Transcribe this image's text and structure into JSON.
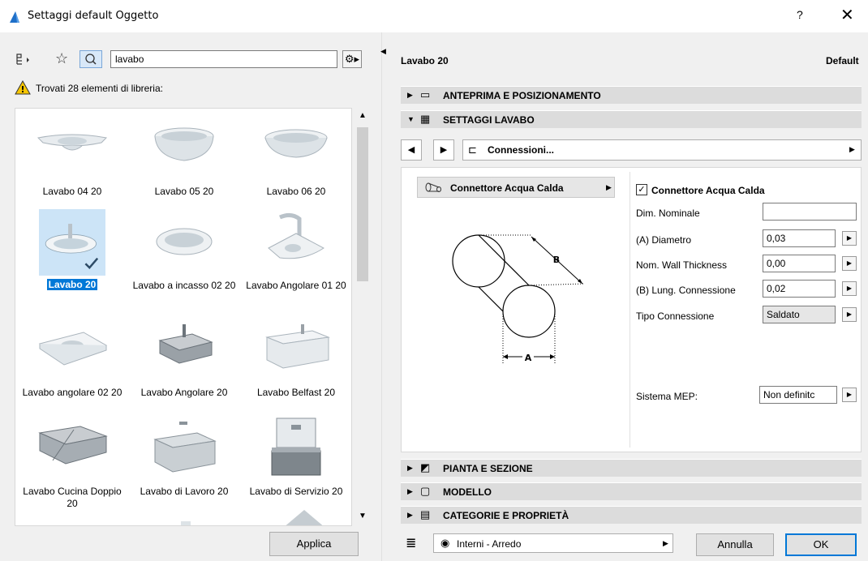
{
  "window": {
    "title": "Settaggi default Oggetto",
    "help": "?",
    "close": "✕"
  },
  "left": {
    "search_value": "lavabo",
    "found_text": "Trovati 28 elementi di libreria:",
    "items": [
      {
        "label": "Lavabo 04 20"
      },
      {
        "label": "Lavabo 05 20"
      },
      {
        "label": "Lavabo 06 20"
      },
      {
        "label": "Lavabo 20"
      },
      {
        "label": "Lavabo a incasso 02 20"
      },
      {
        "label": "Lavabo Angolare 01 20"
      },
      {
        "label": "Lavabo angolare 02 20"
      },
      {
        "label": "Lavabo Angolare 20"
      },
      {
        "label": "Lavabo Belfast 20"
      },
      {
        "label": "Lavabo Cucina Doppio 20"
      },
      {
        "label": "Lavabo di Lavoro 20"
      },
      {
        "label": "Lavabo di Servizio 20"
      }
    ],
    "apply_label": "Applica"
  },
  "right": {
    "object_name": "Lavabo 20",
    "default_label": "Default",
    "sections": {
      "preview": "ANTEPRIMA E POSIZIONAMENTO",
      "settings": "SETTAGGI LAVABO",
      "plan": "PIANTA E SEZIONE",
      "model": "MODELLO",
      "categories": "CATEGORIE E PROPRIETÀ"
    },
    "nav_page": "Connessioni...",
    "connector_dropdown": "Connettore Acqua Calda",
    "diagram": {
      "label_a": "A",
      "label_b": "B"
    },
    "connector_checkbox": "Connettore Acqua Calda",
    "params": {
      "dim_nominale": {
        "label": "Dim. Nominale",
        "value": ""
      },
      "diametro": {
        "label": "(A) Diametro",
        "value": "0,03"
      },
      "wall": {
        "label": "Nom. Wall Thickness",
        "value": "0,00"
      },
      "lung": {
        "label": "(B) Lung. Connessione",
        "value": "0,02"
      },
      "tipo": {
        "label": "Tipo Connessione",
        "value": "Saldato"
      },
      "mep": {
        "label": "Sistema MEP:",
        "value": "Non definitc"
      }
    },
    "layer": "Interni - Arredo",
    "cancel_label": "Annulla",
    "ok_label": "OK"
  }
}
